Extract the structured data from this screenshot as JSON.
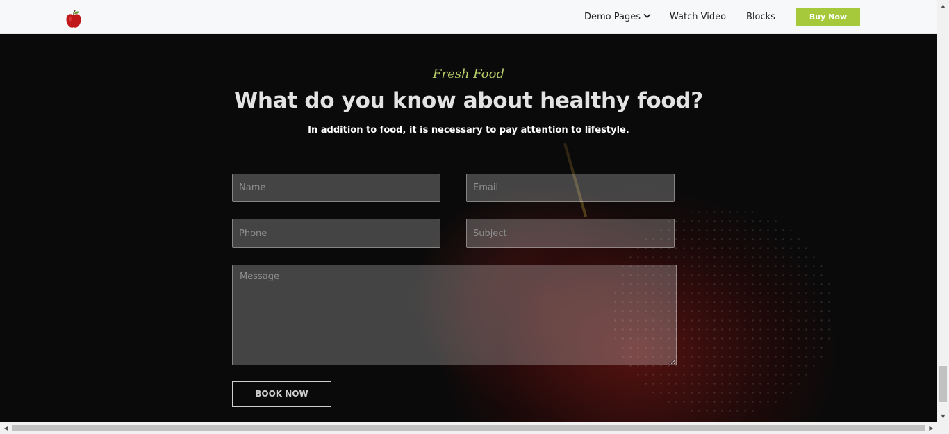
{
  "nav": {
    "logo_icon": "apple-icon",
    "items": [
      {
        "label": "Demo Pages",
        "has_dropdown": true
      },
      {
        "label": "Watch Video"
      },
      {
        "label": "Blocks"
      }
    ],
    "cta_label": "Buy Now",
    "accent_color": "#a5c93a"
  },
  "hero": {
    "kicker": "Fresh Food",
    "title": "What do you know about healthy food?",
    "subtitle": "In addition to food, it is necessary to pay attention to lifestyle."
  },
  "form": {
    "name_placeholder": "Name",
    "email_placeholder": "Email",
    "phone_placeholder": "Phone",
    "subject_placeholder": "Subject",
    "message_placeholder": "Message",
    "submit_label": "BOOK NOW"
  }
}
